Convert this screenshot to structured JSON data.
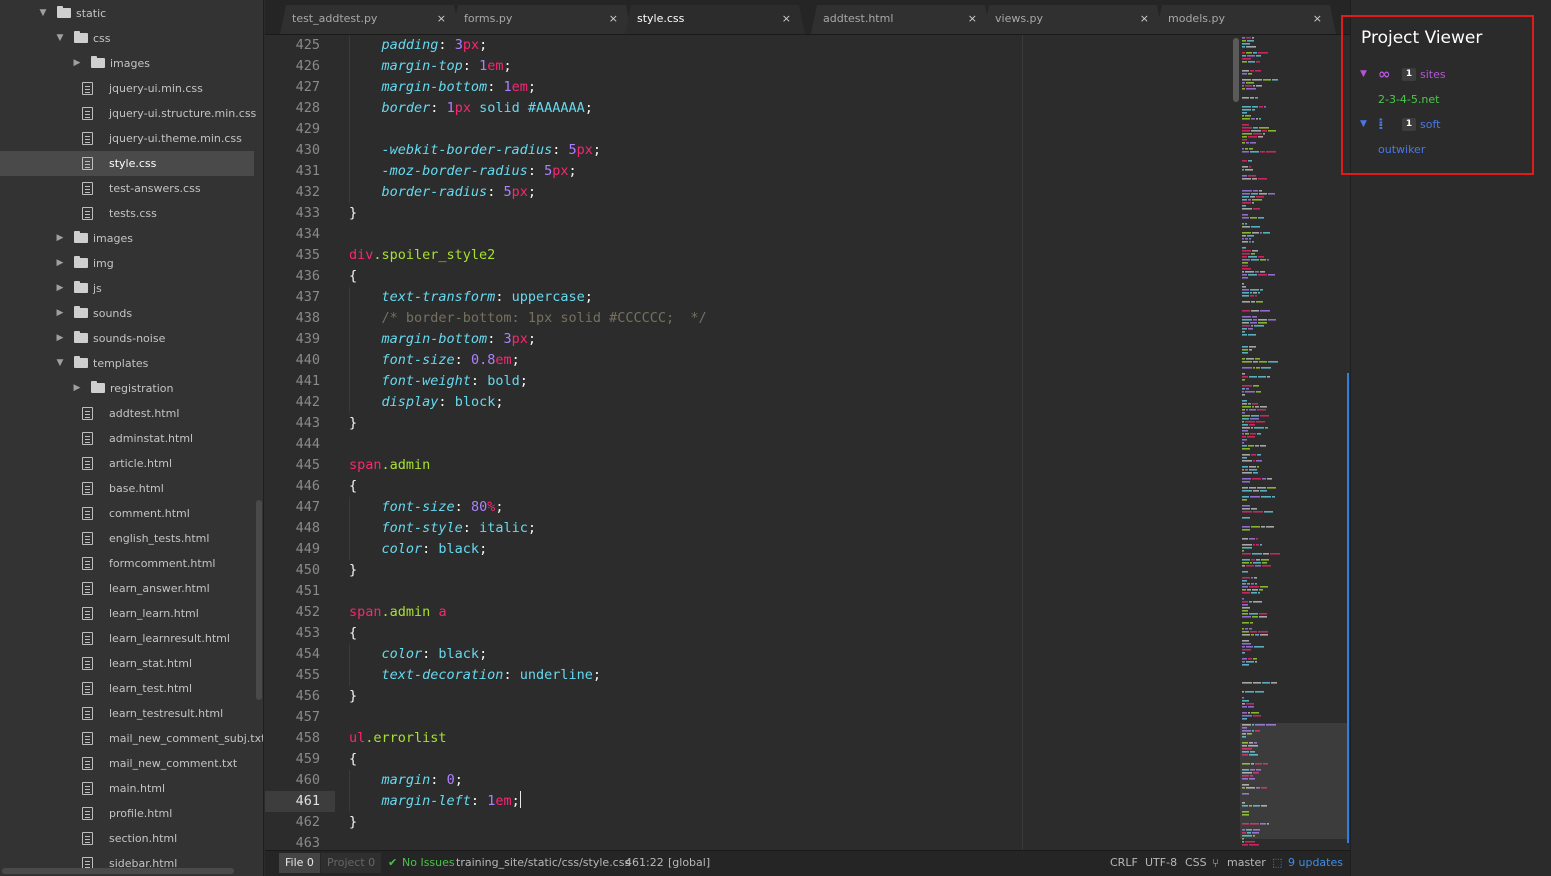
{
  "tree": {
    "items": [
      {
        "label": "static",
        "type": "folder",
        "depth": 0,
        "expanded": true
      },
      {
        "label": "css",
        "type": "folder",
        "depth": 1,
        "expanded": true
      },
      {
        "label": "images",
        "type": "folder",
        "depth": 2,
        "expanded": false
      },
      {
        "label": "jquery-ui.min.css",
        "type": "file",
        "depth": 2
      },
      {
        "label": "jquery-ui.structure.min.css",
        "type": "file",
        "depth": 2
      },
      {
        "label": "jquery-ui.theme.min.css",
        "type": "file",
        "depth": 2
      },
      {
        "label": "style.css",
        "type": "file",
        "depth": 2,
        "selected": true
      },
      {
        "label": "test-answers.css",
        "type": "file",
        "depth": 2
      },
      {
        "label": "tests.css",
        "type": "file",
        "depth": 2
      },
      {
        "label": "images",
        "type": "folder",
        "depth": 1,
        "expanded": false
      },
      {
        "label": "img",
        "type": "folder",
        "depth": 1,
        "expanded": false
      },
      {
        "label": "js",
        "type": "folder",
        "depth": 1,
        "expanded": false
      },
      {
        "label": "sounds",
        "type": "folder",
        "depth": 1,
        "expanded": false
      },
      {
        "label": "sounds-noise",
        "type": "folder",
        "depth": 1,
        "expanded": false
      },
      {
        "label": "templates",
        "type": "folder",
        "depth": 1,
        "expanded": true
      },
      {
        "label": "registration",
        "type": "folder",
        "depth": 2,
        "expanded": false
      },
      {
        "label": "addtest.html",
        "type": "file",
        "depth": 2
      },
      {
        "label": "adminstat.html",
        "type": "file",
        "depth": 2
      },
      {
        "label": "article.html",
        "type": "file",
        "depth": 2
      },
      {
        "label": "base.html",
        "type": "file",
        "depth": 2
      },
      {
        "label": "comment.html",
        "type": "file",
        "depth": 2
      },
      {
        "label": "english_tests.html",
        "type": "file",
        "depth": 2
      },
      {
        "label": "formcomment.html",
        "type": "file",
        "depth": 2
      },
      {
        "label": "learn_answer.html",
        "type": "file",
        "depth": 2
      },
      {
        "label": "learn_learn.html",
        "type": "file",
        "depth": 2
      },
      {
        "label": "learn_learnresult.html",
        "type": "file",
        "depth": 2
      },
      {
        "label": "learn_stat.html",
        "type": "file",
        "depth": 2
      },
      {
        "label": "learn_test.html",
        "type": "file",
        "depth": 2
      },
      {
        "label": "learn_testresult.html",
        "type": "file",
        "depth": 2
      },
      {
        "label": "mail_new_comment_subj.txt",
        "type": "file",
        "depth": 2
      },
      {
        "label": "mail_new_comment.txt",
        "type": "file",
        "depth": 2
      },
      {
        "label": "main.html",
        "type": "file",
        "depth": 2
      },
      {
        "label": "profile.html",
        "type": "file",
        "depth": 2
      },
      {
        "label": "section.html",
        "type": "file",
        "depth": 2
      },
      {
        "label": "sidebar.html",
        "type": "file",
        "depth": 2
      }
    ]
  },
  "tabs": [
    {
      "label": "test_addtest.py",
      "active": false
    },
    {
      "label": "forms.py",
      "active": false
    },
    {
      "label": "style.css",
      "active": true
    },
    {
      "label": "addtest.html",
      "active": false
    },
    {
      "label": "views.py",
      "active": false
    },
    {
      "label": "models.py",
      "active": false
    }
  ],
  "tab_close_glyph": "×",
  "editor": {
    "current_line": 461,
    "lines": [
      {
        "n": 425,
        "tokens": [
          [
            "i1",
            ""
          ],
          [
            "prop",
            "padding"
          ],
          [
            "punc",
            ": "
          ],
          [
            "num",
            "3"
          ],
          [
            "unit",
            "px"
          ],
          [
            "punc",
            ";"
          ]
        ]
      },
      {
        "n": 426,
        "tokens": [
          [
            "i1",
            ""
          ],
          [
            "prop",
            "margin-top"
          ],
          [
            "punc",
            ": "
          ],
          [
            "num",
            "1"
          ],
          [
            "unit",
            "em"
          ],
          [
            "punc",
            ";"
          ]
        ]
      },
      {
        "n": 427,
        "tokens": [
          [
            "i1",
            ""
          ],
          [
            "prop",
            "margin-bottom"
          ],
          [
            "punc",
            ": "
          ],
          [
            "num",
            "1"
          ],
          [
            "unit",
            "em"
          ],
          [
            "punc",
            ";"
          ]
        ]
      },
      {
        "n": 428,
        "tokens": [
          [
            "i1",
            ""
          ],
          [
            "prop",
            "border"
          ],
          [
            "punc",
            ": "
          ],
          [
            "num",
            "1"
          ],
          [
            "unit",
            "px"
          ],
          [
            "punc",
            " "
          ],
          [
            "val",
            "solid"
          ],
          [
            "punc",
            " "
          ],
          [
            "val",
            "#AAAAAA"
          ],
          [
            "punc",
            ";"
          ]
        ]
      },
      {
        "n": 429,
        "tokens": []
      },
      {
        "n": 430,
        "tokens": [
          [
            "i1",
            ""
          ],
          [
            "prop",
            "-webkit-border-radius"
          ],
          [
            "punc",
            ": "
          ],
          [
            "num",
            "5"
          ],
          [
            "unit",
            "px"
          ],
          [
            "punc",
            ";"
          ]
        ]
      },
      {
        "n": 431,
        "tokens": [
          [
            "i1",
            ""
          ],
          [
            "prop",
            "-moz-border-radius"
          ],
          [
            "punc",
            ": "
          ],
          [
            "num",
            "5"
          ],
          [
            "unit",
            "px"
          ],
          [
            "punc",
            ";"
          ]
        ]
      },
      {
        "n": 432,
        "tokens": [
          [
            "i1",
            ""
          ],
          [
            "prop",
            "border-radius"
          ],
          [
            "punc",
            ": "
          ],
          [
            "num",
            "5"
          ],
          [
            "unit",
            "px"
          ],
          [
            "punc",
            ";"
          ]
        ]
      },
      {
        "n": 433,
        "tokens": [
          [
            "plain",
            "}"
          ]
        ]
      },
      {
        "n": 434,
        "tokens": []
      },
      {
        "n": 435,
        "tokens": [
          [
            "tag",
            "div"
          ],
          [
            "cls",
            ".spoiler_style2"
          ]
        ]
      },
      {
        "n": 436,
        "tokens": [
          [
            "plain",
            "{"
          ]
        ]
      },
      {
        "n": 437,
        "tokens": [
          [
            "i1",
            ""
          ],
          [
            "prop",
            "text-transform"
          ],
          [
            "punc",
            ": "
          ],
          [
            "val",
            "uppercase"
          ],
          [
            "punc",
            ";"
          ]
        ]
      },
      {
        "n": 438,
        "tokens": [
          [
            "i1",
            ""
          ],
          [
            "comment",
            "/* border-bottom: 1px solid #CCCCCC;  */"
          ]
        ]
      },
      {
        "n": 439,
        "tokens": [
          [
            "i1",
            ""
          ],
          [
            "prop",
            "margin-bottom"
          ],
          [
            "punc",
            ": "
          ],
          [
            "num",
            "3"
          ],
          [
            "unit",
            "px"
          ],
          [
            "punc",
            ";"
          ]
        ]
      },
      {
        "n": 440,
        "tokens": [
          [
            "i1",
            ""
          ],
          [
            "prop",
            "font-size"
          ],
          [
            "punc",
            ": "
          ],
          [
            "num",
            "0.8"
          ],
          [
            "unit",
            "em"
          ],
          [
            "punc",
            ";"
          ]
        ]
      },
      {
        "n": 441,
        "tokens": [
          [
            "i1",
            ""
          ],
          [
            "prop",
            "font-weight"
          ],
          [
            "punc",
            ": "
          ],
          [
            "val",
            "bold"
          ],
          [
            "punc",
            ";"
          ]
        ]
      },
      {
        "n": 442,
        "tokens": [
          [
            "i1",
            ""
          ],
          [
            "prop",
            "display"
          ],
          [
            "punc",
            ": "
          ],
          [
            "val",
            "block"
          ],
          [
            "punc",
            ";"
          ]
        ]
      },
      {
        "n": 443,
        "tokens": [
          [
            "plain",
            "}"
          ]
        ]
      },
      {
        "n": 444,
        "tokens": []
      },
      {
        "n": 445,
        "tokens": [
          [
            "tag",
            "span"
          ],
          [
            "cls",
            ".admin"
          ]
        ]
      },
      {
        "n": 446,
        "tokens": [
          [
            "plain",
            "{"
          ]
        ]
      },
      {
        "n": 447,
        "tokens": [
          [
            "i1",
            ""
          ],
          [
            "prop",
            "font-size"
          ],
          [
            "punc",
            ": "
          ],
          [
            "num",
            "80"
          ],
          [
            "unit",
            "%"
          ],
          [
            "punc",
            ";"
          ]
        ]
      },
      {
        "n": 448,
        "tokens": [
          [
            "i1",
            ""
          ],
          [
            "prop",
            "font-style"
          ],
          [
            "punc",
            ": "
          ],
          [
            "val",
            "italic"
          ],
          [
            "punc",
            ";"
          ]
        ]
      },
      {
        "n": 449,
        "tokens": [
          [
            "i1",
            ""
          ],
          [
            "prop",
            "color"
          ],
          [
            "punc",
            ": "
          ],
          [
            "val",
            "black"
          ],
          [
            "punc",
            ";"
          ]
        ]
      },
      {
        "n": 450,
        "tokens": [
          [
            "plain",
            "}"
          ]
        ]
      },
      {
        "n": 451,
        "tokens": []
      },
      {
        "n": 452,
        "tokens": [
          [
            "tag",
            "span"
          ],
          [
            "cls",
            ".admin"
          ],
          [
            "punc",
            " "
          ],
          [
            "tag",
            "a"
          ]
        ]
      },
      {
        "n": 453,
        "tokens": [
          [
            "plain",
            "{"
          ]
        ]
      },
      {
        "n": 454,
        "tokens": [
          [
            "i1",
            ""
          ],
          [
            "prop",
            "color"
          ],
          [
            "punc",
            ": "
          ],
          [
            "val",
            "black"
          ],
          [
            "punc",
            ";"
          ]
        ]
      },
      {
        "n": 455,
        "tokens": [
          [
            "i1",
            ""
          ],
          [
            "prop",
            "text-decoration"
          ],
          [
            "punc",
            ": "
          ],
          [
            "val",
            "underline"
          ],
          [
            "punc",
            ";"
          ]
        ]
      },
      {
        "n": 456,
        "tokens": [
          [
            "plain",
            "}"
          ]
        ]
      },
      {
        "n": 457,
        "tokens": []
      },
      {
        "n": 458,
        "tokens": [
          [
            "tag",
            "ul"
          ],
          [
            "cls",
            ".errorlist"
          ]
        ]
      },
      {
        "n": 459,
        "tokens": [
          [
            "plain",
            "{"
          ]
        ]
      },
      {
        "n": 460,
        "tokens": [
          [
            "i1",
            ""
          ],
          [
            "prop",
            "margin"
          ],
          [
            "punc",
            ": "
          ],
          [
            "num",
            "0"
          ],
          [
            "punc",
            ";"
          ]
        ]
      },
      {
        "n": 461,
        "tokens": [
          [
            "i1",
            ""
          ],
          [
            "prop",
            "margin-left"
          ],
          [
            "punc",
            ": "
          ],
          [
            "num",
            "1"
          ],
          [
            "unit",
            "em"
          ],
          [
            "punc",
            ";"
          ],
          [
            "caret",
            ""
          ]
        ]
      },
      {
        "n": 462,
        "tokens": [
          [
            "plain",
            "}"
          ]
        ]
      },
      {
        "n": 463,
        "tokens": []
      }
    ]
  },
  "status": {
    "file_label": "File 0",
    "project_label": "Project 0",
    "issues_label": "No Issues",
    "path": "training_site/static/css/style.css",
    "cursor": "461:22",
    "scope": "[global]",
    "line_ending": "CRLF",
    "encoding": "UTF-8",
    "grammar": "CSS",
    "branch": "master",
    "updates_label": "9 updates"
  },
  "project_viewer": {
    "title": "Project Viewer",
    "groups": [
      {
        "count": "1",
        "label": "sites",
        "icon": "link-icon",
        "color": "#b455d6",
        "project": "2-3-4-5.net",
        "project_color": "#4bc84b"
      },
      {
        "count": "1",
        "label": "soft",
        "icon": "footprints-icon",
        "color": "#4a78e8",
        "project": "outwiker",
        "project_color": "#4a78e8"
      }
    ]
  },
  "colors": {
    "accent_blue": "#2f7fdd",
    "highlight_red": "#e01b1b"
  }
}
